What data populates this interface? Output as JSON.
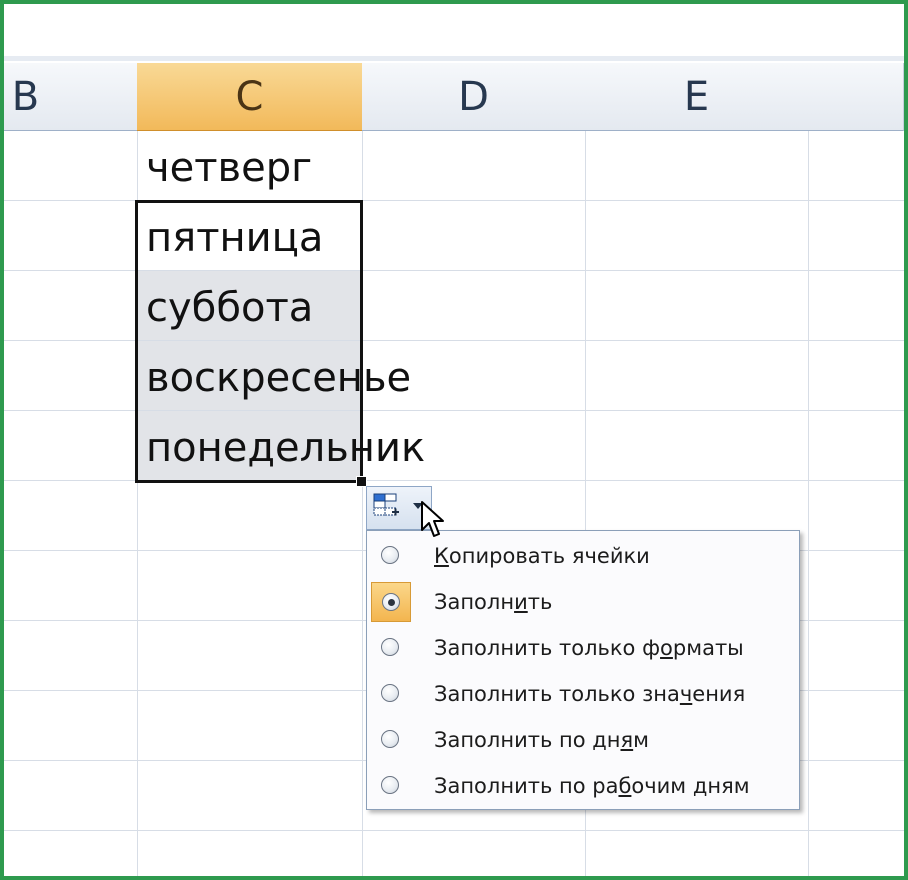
{
  "columns": [
    {
      "label": "B",
      "selected": false
    },
    {
      "label": "C",
      "selected": true
    },
    {
      "label": "D",
      "selected": false
    },
    {
      "label": "E",
      "selected": false
    },
    {
      "label": "",
      "selected": false
    }
  ],
  "cells": {
    "c1": "четверг",
    "c2": "пятница",
    "c3": "суббота",
    "c4": "воскресенье",
    "c5": "понедельник"
  },
  "autofill_menu": {
    "button_icon": "autofill-options-icon",
    "items": [
      {
        "pre": "",
        "accel": "К",
        "post": "опировать ячейки",
        "checked": false
      },
      {
        "pre": "Заполн",
        "accel": "и",
        "post": "ть",
        "checked": true
      },
      {
        "pre": "Заполнить только ф",
        "accel": "о",
        "post": "рматы",
        "checked": false
      },
      {
        "pre": "Заполнить только зна",
        "accel": "ч",
        "post": "ения",
        "checked": false
      },
      {
        "pre": "Заполнить по дн",
        "accel": "я",
        "post": "м",
        "checked": false
      },
      {
        "pre": "Заполнить по ра",
        "accel": "б",
        "post": "очим дням",
        "checked": false
      }
    ]
  },
  "colors": {
    "frame": "#2e9a4e",
    "selected_header": "#f2b95a",
    "grid": "#d7dde6"
  }
}
